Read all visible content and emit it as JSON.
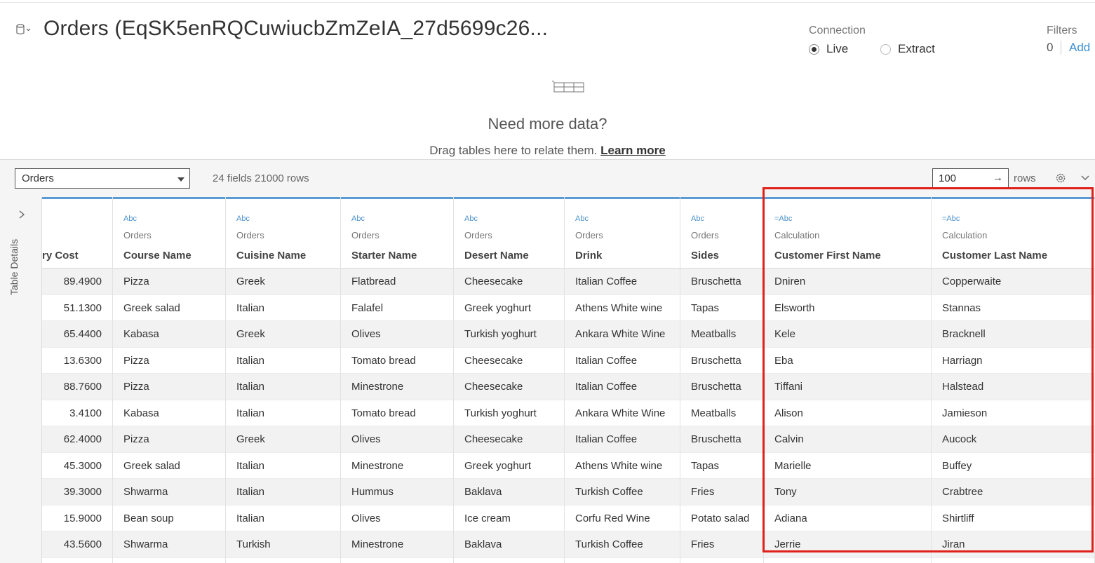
{
  "header": {
    "datasource_title": "Orders (EqSK5enRQCuwiucbZmZeIA_27d5699c26...",
    "connection_label": "Connection",
    "live_label": "Live",
    "extract_label": "Extract",
    "filters_label": "Filters",
    "filters_count": "0",
    "filters_add": "Add"
  },
  "canvas": {
    "need_more": "Need more data?",
    "drag_hint": "Drag tables here to relate them.",
    "learn_more": "Learn more"
  },
  "toolbar": {
    "table_select_value": "Orders",
    "fields_info": "24 fields 21000 rows",
    "rows_value": "100",
    "rows_label": "rows"
  },
  "side": {
    "label": "Table Details"
  },
  "columns": [
    {
      "type": "",
      "source": "",
      "name": "ry Cost",
      "numeric": true,
      "values": [
        "89.4900",
        "51.1300",
        "65.4400",
        "13.6300",
        "88.7600",
        "3.4100",
        "62.4000",
        "45.3000",
        "39.3000",
        "15.9000",
        "43.5600"
      ]
    },
    {
      "type": "Abc",
      "source": "Orders",
      "name": "Course Name",
      "values": [
        "Pizza",
        "Greek salad",
        "Kabasa",
        "Pizza",
        "Pizza",
        "Kabasa",
        "Pizza",
        "Greek salad",
        "Shwarma",
        "Bean soup",
        "Shwarma"
      ]
    },
    {
      "type": "Abc",
      "source": "Orders",
      "name": "Cuisine Name",
      "values": [
        "Greek",
        "Italian",
        "Greek",
        "Italian",
        "Italian",
        "Italian",
        "Greek",
        "Italian",
        "Italian",
        "Italian",
        "Turkish"
      ]
    },
    {
      "type": "Abc",
      "source": "Orders",
      "name": "Starter Name",
      "values": [
        "Flatbread",
        "Falafel",
        "Olives",
        "Tomato bread",
        "Minestrone",
        "Tomato bread",
        "Olives",
        "Minestrone",
        "Hummus",
        "Olives",
        "Minestrone"
      ]
    },
    {
      "type": "Abc",
      "source": "Orders",
      "name": "Desert Name",
      "values": [
        "Cheesecake",
        "Greek yoghurt",
        "Turkish yoghurt",
        "Cheesecake",
        "Cheesecake",
        "Turkish yoghurt",
        "Cheesecake",
        "Greek yoghurt",
        "Baklava",
        "Ice cream",
        "Baklava"
      ]
    },
    {
      "type": "Abc",
      "source": "Orders",
      "name": "Drink",
      "values": [
        "Italian Coffee",
        "Athens White wine",
        "Ankara White Wine",
        "Italian Coffee",
        "Italian Coffee",
        "Ankara White Wine",
        "Italian Coffee",
        "Athens White wine",
        "Turkish Coffee",
        "Corfu Red Wine",
        "Turkish Coffee"
      ]
    },
    {
      "type": "Abc",
      "source": "Orders",
      "name": "Sides",
      "values": [
        "Bruschetta",
        "Tapas",
        "Meatballs",
        "Bruschetta",
        "Bruschetta",
        "Meatballs",
        "Bruschetta",
        "Tapas",
        "Fries",
        "Potato salad",
        "Fries"
      ]
    },
    {
      "type": "=Abc",
      "source": "Calculation",
      "name": "Customer First Name",
      "values": [
        "Dniren",
        "Elsworth",
        "Kele",
        "Eba",
        "Tiffani",
        "Alison",
        "Calvin",
        "Marielle",
        "Tony",
        "Adiana",
        "Jerrie"
      ]
    },
    {
      "type": "=Abc",
      "source": "Calculation",
      "name": "Customer Last Name",
      "values": [
        "Copperwaite",
        "Stannas",
        "Bracknell",
        "Harriagn",
        "Halstead",
        "Jamieson",
        "Aucock",
        "Buffey",
        "Crabtree",
        "Shirtliff",
        "Jiran"
      ]
    }
  ]
}
